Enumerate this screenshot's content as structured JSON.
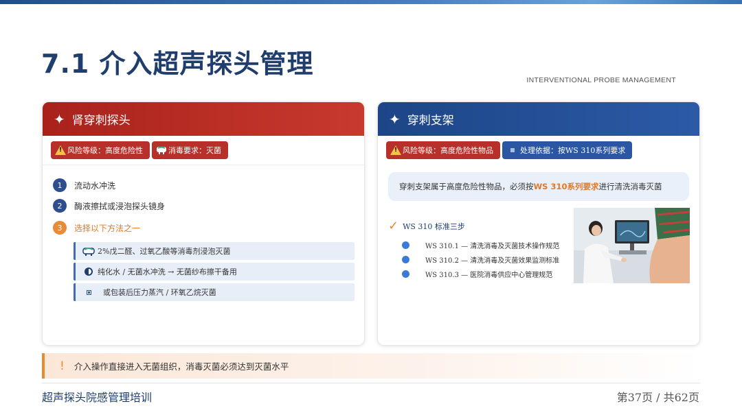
{
  "header": {
    "title": "7.1 介入超声探头管理",
    "subtitle": "INTERVENTIONAL PROBE MANAGEMENT"
  },
  "left_card": {
    "title": "肾穿刺探头",
    "tags": [
      "风险等级：高度危险性",
      "消毒要求：灭菌"
    ],
    "steps": [
      {
        "num": "1",
        "text": "流动水冲洗"
      },
      {
        "num": "2",
        "text": "酶液擦拭或浸泡探头镜身"
      },
      {
        "num": "3",
        "text": "选择以下方法之一"
      }
    ],
    "methods": [
      "2%戊二醛、过氧乙酸等消毒剂浸泡灭菌",
      "纯化水 / 无菌水冲洗 → 无菌纱布擦干备用",
      "或包装后压力蒸汽 / 环氧乙烷灭菌"
    ]
  },
  "right_card": {
    "title": "穿刺支架",
    "tags": [
      "风险等级：高度危险性物品",
      "处理依据：按WS 310系列要求"
    ],
    "note": {
      "prefix": "穿刺支架属于高度危险性物品，必须按 ",
      "highlight": "WS 310系列要求",
      "suffix": " 进行清洗消毒灭菌"
    },
    "ws_title": "WS 310 标准三步",
    "ws_items": [
      "WS 310.1 — 清洗消毒及灭菌技术操作规范",
      "WS 310.2 — 清洗消毒及灭菌效果监测标准",
      "WS 310.3 — 医院消毒供应中心管理规范"
    ]
  },
  "alert": {
    "mark": "!",
    "text": "介入操作直接进入无菌组织，消毒灭菌必须达到灭菌水平"
  },
  "footer": {
    "left": "超声探头院感管理培训",
    "right": "第37页 / 共62页"
  },
  "colors": {
    "red_header": "#b8302a",
    "blue_header": "#2a56a4",
    "title_navy": "#1f3e6e",
    "accent_orange": "#e98a35"
  },
  "icons": {
    "head": "sparkle-star-icon",
    "warning": "warning-triangle-icon",
    "disinfect": "disinfect-basin-icon",
    "document": "document-square-icon",
    "check": "checkmark-icon"
  }
}
